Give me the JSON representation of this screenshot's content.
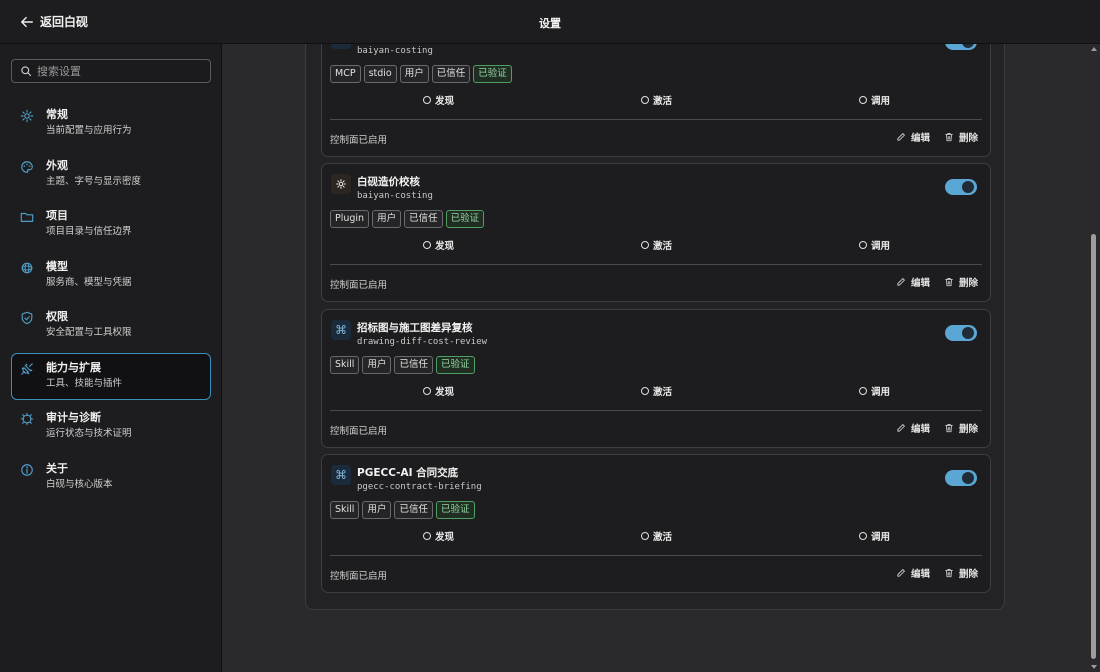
{
  "header": {
    "back_label": "返回白砚",
    "title": "设置"
  },
  "search": {
    "placeholder": "搜索设置"
  },
  "sidebar": {
    "items": [
      {
        "title": "常规",
        "subtitle": "当前配置与应用行为",
        "icon": "gear-icon"
      },
      {
        "title": "外观",
        "subtitle": "主题、字号与显示密度",
        "icon": "palette-icon"
      },
      {
        "title": "项目",
        "subtitle": "项目目录与信任边界",
        "icon": "folder-icon"
      },
      {
        "title": "模型",
        "subtitle": "服务商、模型与凭据",
        "icon": "model-icon"
      },
      {
        "title": "权限",
        "subtitle": "安全配置与工具权限",
        "icon": "shield-icon"
      },
      {
        "title": "能力与扩展",
        "subtitle": "工具、技能与插件",
        "icon": "plug-icon"
      },
      {
        "title": "审计与诊断",
        "subtitle": "运行状态与技术证明",
        "icon": "audit-icon"
      },
      {
        "title": "关于",
        "subtitle": "白砚与核心版本",
        "icon": "info-icon"
      }
    ],
    "active_index": 5
  },
  "cards": [
    {
      "title": "",
      "id": "baiyan-costing",
      "icon": "mcp-icon",
      "tags": [
        "MCP",
        "stdio",
        "用户",
        "已信任",
        "已验证"
      ],
      "stages": [
        "发现",
        "激活",
        "调用"
      ],
      "status": "控制面已启用",
      "edit_label": "编辑",
      "delete_label": "删除",
      "enabled": true
    },
    {
      "title": "白砚造价校核",
      "id": "baiyan-costing",
      "icon": "plugin-icon",
      "tags": [
        "Plugin",
        "用户",
        "已信任",
        "已验证"
      ],
      "stages": [
        "发现",
        "激活",
        "调用"
      ],
      "status": "控制面已启用",
      "edit_label": "编辑",
      "delete_label": "删除",
      "enabled": true
    },
    {
      "title": "招标图与施工图差异复核",
      "id": "drawing-diff-cost-review",
      "icon": "command-icon",
      "tags": [
        "Skill",
        "用户",
        "已信任",
        "已验证"
      ],
      "stages": [
        "发现",
        "激活",
        "调用"
      ],
      "status": "控制面已启用",
      "edit_label": "编辑",
      "delete_label": "删除",
      "enabled": true
    },
    {
      "title": "PGECC-AI 合同交底",
      "id": "pgecc-contract-briefing",
      "icon": "command-icon",
      "tags": [
        "Skill",
        "用户",
        "已信任",
        "已验证"
      ],
      "stages": [
        "发现",
        "激活",
        "调用"
      ],
      "status": "控制面已启用",
      "edit_label": "编辑",
      "delete_label": "删除",
      "enabled": true
    }
  ],
  "colors": {
    "accent": "#5aa6d4",
    "verified": "#96d6a2",
    "active_border": "#3b8fb8"
  }
}
